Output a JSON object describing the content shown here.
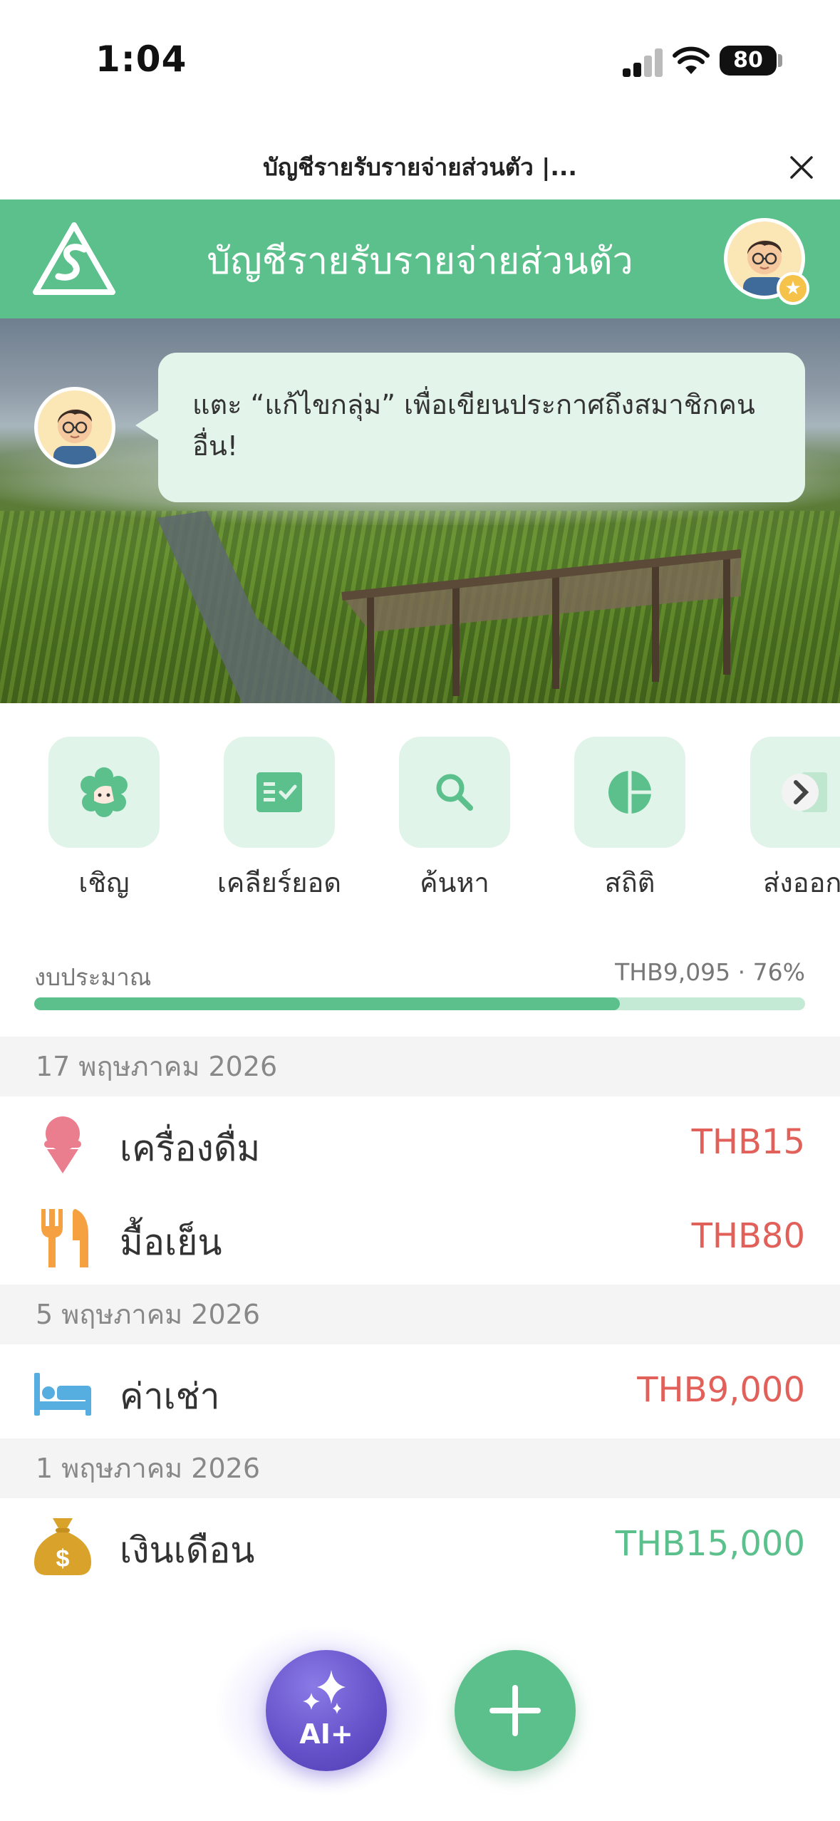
{
  "status_bar": {
    "time": "1:04",
    "battery": "80"
  },
  "page": {
    "title": "บัญชีรายรับรายจ่ายส่วนตัว |..."
  },
  "header": {
    "title": "บัญชีรายรับรายจ่ายส่วนตัว"
  },
  "announcement": {
    "text": "แตะ “แก้ไขกลุ่ม” เพื่อเขียนประกาศถึงสมาชิกคนอื่น!"
  },
  "actions": [
    {
      "label": "เชิญ",
      "icon": "invite-face-icon"
    },
    {
      "label": "เคลียร์ยอด",
      "icon": "checklist-icon"
    },
    {
      "label": "ค้นหา",
      "icon": "search-icon"
    },
    {
      "label": "สถิติ",
      "icon": "pie-chart-icon"
    },
    {
      "label": "ส่งออก",
      "icon": "export-icon"
    }
  ],
  "budget": {
    "label": "งบประมาณ",
    "value_text": "THB9,095 · 76%",
    "progress": 0.76
  },
  "transactions": [
    {
      "date": "17 พฤษภาคม 2026",
      "items": [
        {
          "name": "เครื่องดื่ม",
          "amount": "THB15",
          "type": "expense",
          "icon": "ice-cream-icon"
        },
        {
          "name": "มื้อเย็น",
          "amount": "THB80",
          "type": "expense",
          "icon": "fork-knife-icon"
        }
      ]
    },
    {
      "date": "5 พฤษภาคม 2026",
      "items": [
        {
          "name": "ค่าเช่า",
          "amount": "THB9,000",
          "type": "expense",
          "icon": "bed-icon"
        }
      ]
    },
    {
      "date": "1 พฤษภาคม 2026",
      "items": [
        {
          "name": "เงินเดือน",
          "amount": "THB15,000",
          "type": "income",
          "icon": "money-bag-icon"
        }
      ]
    }
  ],
  "fab": {
    "ai_label": "AI+"
  },
  "colors": {
    "brand_green": "#5bc08b",
    "expense_red": "#e2605a",
    "ai_purple": "#6450c8"
  }
}
